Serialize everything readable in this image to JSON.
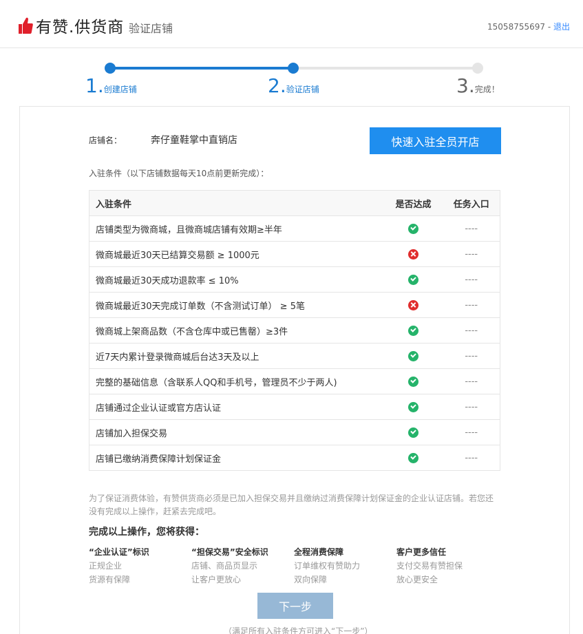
{
  "header": {
    "logo_text": "有赞.供货商",
    "page_subtitle": "验证店铺",
    "phone": "15058755697",
    "separator": " - ",
    "logout_label": "退出"
  },
  "steps": [
    {
      "num": "1.",
      "label": "创建店铺",
      "state": "done"
    },
    {
      "num": "2.",
      "label": "验证店铺",
      "state": "current"
    },
    {
      "num": "3.",
      "label": "完成！",
      "state": "todo"
    }
  ],
  "store": {
    "label": "店铺名：",
    "name": "奔仔童鞋掌中直销店",
    "fast_button": "快速入驻全员开店"
  },
  "conditions_note": "入驻条件（以下店铺数据每天10点前更新完成）：",
  "table": {
    "headers": [
      "入驻条件",
      "是否达成",
      "任务入口"
    ],
    "rows": [
      {
        "condition": "店铺类型为微商城，且微商城店铺有效期≥半年",
        "status": "ok",
        "entry": "----"
      },
      {
        "condition": "微商城最近30天已结算交易额 ≥ 1000元",
        "status": "fail",
        "entry": "----"
      },
      {
        "condition": "微商城最近30天成功退款率 ≤ 10%",
        "status": "ok",
        "entry": "----"
      },
      {
        "condition": "微商城最近30天完成订单数（不含测试订单） ≥ 5笔",
        "status": "fail",
        "entry": "----"
      },
      {
        "condition": "微商城上架商品数（不含仓库中或已售罄）≥3件",
        "status": "ok",
        "entry": "----"
      },
      {
        "condition": "近7天内累计登录微商城后台达3天及以上",
        "status": "ok",
        "entry": "----"
      },
      {
        "condition": "完整的基础信息（含联系人QQ和手机号，管理员不少于两人)",
        "status": "ok",
        "entry": "----"
      },
      {
        "condition": "店铺通过企业认证或官方店认证",
        "status": "ok",
        "entry": "----"
      },
      {
        "condition": "店铺加入担保交易",
        "status": "ok",
        "entry": "----"
      },
      {
        "condition": "店铺已缴纳消费保障计划保证金",
        "status": "ok",
        "entry": "----"
      }
    ]
  },
  "notice": "为了保证消费体验，有赞供货商必须是已加入担保交易并且缴纳过消费保障计划保证金的企业认证店铺。若您还没有完成以上操作，赶紧去完成吧。",
  "gain_title": "完成以上操作，您将获得：",
  "benefits": [
    {
      "title": "“企业认证”标识",
      "line1": "正规企业",
      "line2": "货源有保障"
    },
    {
      "title": "“担保交易”安全标识",
      "line1": "店铺、商品页显示",
      "line2": "让客户更放心"
    },
    {
      "title": "全程消费保障",
      "line1": "订单维权有赞助力",
      "line2": "双向保障"
    },
    {
      "title": "客户更多信任",
      "line1": "支付交易有赞担保",
      "line2": "放心更安全"
    }
  ],
  "next_button": "下一步",
  "next_hint": "（满足所有入驻条件方可进入“下一步”）",
  "colors": {
    "accent": "#1a7bd1",
    "primary_button": "#1f8eef",
    "disabled_button": "#97b8d6",
    "ok": "#25b36a",
    "fail": "#e02d2d",
    "logo_red": "#e0202b"
  }
}
